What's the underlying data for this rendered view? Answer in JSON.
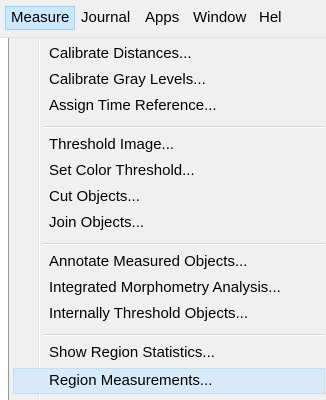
{
  "menubar": {
    "items": [
      "Measure",
      "Journal",
      "Apps",
      "Window",
      "Hel"
    ]
  },
  "measure_menu": {
    "items": [
      "Calibrate Distances...",
      "Calibrate Gray Levels...",
      "Assign Time Reference...",
      "Threshold Image...",
      "Set Color Threshold...",
      "Cut Objects...",
      "Join Objects...",
      "Annotate Measured Objects...",
      "Integrated Morphometry Analysis...",
      "Internally Threshold Objects...",
      "Show Region Statistics...",
      "Region Measurements..."
    ],
    "highlighted": "Region Measurements..."
  },
  "colors": {
    "menu_background": "#f0f0f0",
    "active_menubar_item": "#cce8ff",
    "hover_item": "#d8eaf9"
  }
}
